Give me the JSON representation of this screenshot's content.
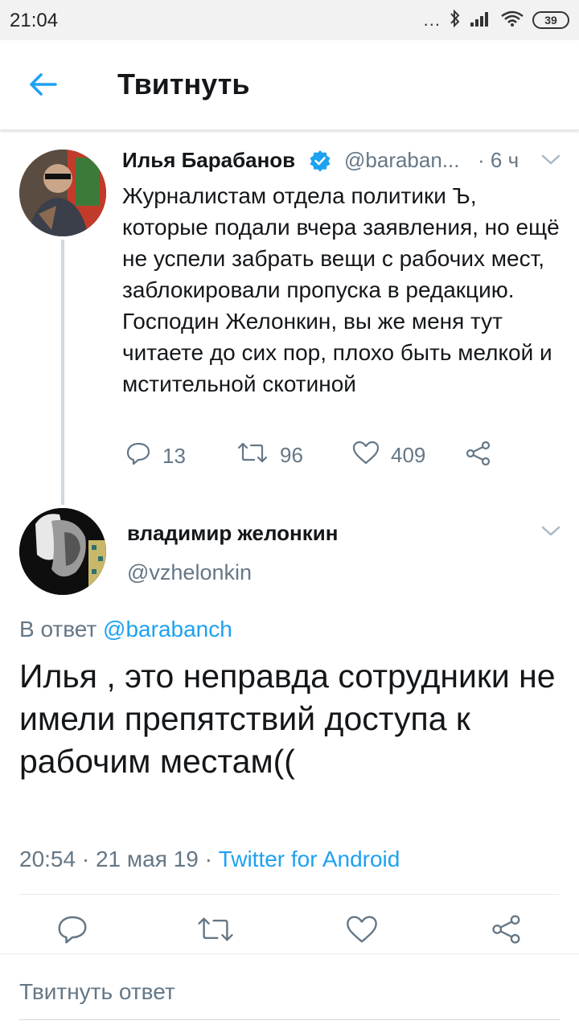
{
  "status_bar": {
    "time": "21:04",
    "signal_dots": "...",
    "battery_level": "39",
    "icons": [
      "bluetooth-icon",
      "signal-icon",
      "wifi-icon",
      "battery-icon"
    ]
  },
  "header": {
    "back_icon": "arrow-left-icon",
    "title": "Твитнуть"
  },
  "parent_tweet": {
    "author_name": "Илья Барабанов",
    "verified_icon": "verified-badge-icon",
    "handle": "@baraban...",
    "time": "· 6 ч",
    "text": "Журналистам отдела политики Ъ, которые подали вчера заявления, но ещё не успели забрать вещи с рабочих мест, заблокировали пропуска в редакцию. Господин Желонкин, вы же меня тут читаете до сих пор, плохо быть мелкой и мстительной скотиной",
    "replies": "13",
    "retweets": "96",
    "likes": "409"
  },
  "main_tweet": {
    "author_name": "владимир желонкин",
    "handle": "@vzhelonkin",
    "reply_prefix": "В ответ",
    "reply_to": "@barabanch",
    "text": "Илья , это неправда сотрудники не имели препятствий доступа к рабочим местам((",
    "timestamp": "20:54 · 21 мая 19 ·",
    "source": "Twitter for Android"
  },
  "reply_box": {
    "placeholder": "Твитнуть ответ"
  },
  "colors": {
    "accent": "#1da1f2",
    "secondary_text": "#657786",
    "primary_text": "#14171a"
  }
}
